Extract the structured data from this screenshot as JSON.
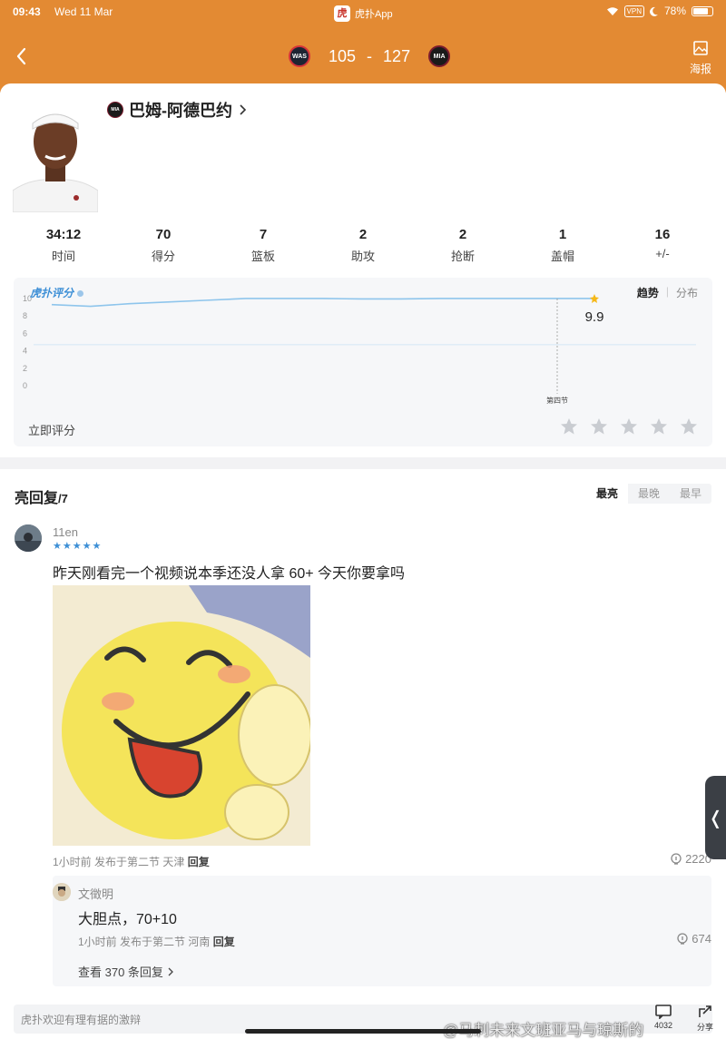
{
  "status_bar": {
    "time": "09:43",
    "date": "Wed 11 Mar",
    "app_name": "虎扑App",
    "vpn": "VPN",
    "battery": "78%"
  },
  "header": {
    "home_team": "WAS",
    "away_team": "MIA",
    "home_score": "105",
    "dash": "-",
    "away_score": "127",
    "poster_label": "海报"
  },
  "player": {
    "name": "巴姆-阿德巴约",
    "team": "MIA",
    "stats": [
      {
        "value": "34:12",
        "label": "时间"
      },
      {
        "value": "70",
        "label": "得分"
      },
      {
        "value": "7",
        "label": "篮板"
      },
      {
        "value": "2",
        "label": "助攻"
      },
      {
        "value": "2",
        "label": "抢断"
      },
      {
        "value": "1",
        "label": "盖帽"
      },
      {
        "value": "16",
        "label": "+/-"
      }
    ]
  },
  "rating": {
    "logo": "虎扑评分",
    "tab_trend": "趋势",
    "tab_distribution": "分布",
    "rate_now": "立即评分",
    "star_count": 5
  },
  "chart_data": {
    "type": "line",
    "title": "",
    "ylim": [
      0,
      10
    ],
    "yticks": [
      "10",
      "8",
      "6",
      "4",
      "2",
      "0"
    ],
    "marker_label": "第四节",
    "current_value": "9.9",
    "series": [
      {
        "values": [
          9.2,
          9.0,
          9.3,
          9.5,
          9.7,
          9.9,
          9.9,
          9.9,
          9.85,
          9.85,
          9.9,
          9.9,
          9.9,
          9.9,
          9.9
        ]
      }
    ],
    "reference_line": 4.6,
    "color": "#8ec5ec"
  },
  "replies": {
    "title": "亮回复",
    "count": "/7",
    "sort_tabs": [
      "最亮",
      "最晚",
      "最早"
    ],
    "comment": {
      "user": "11en",
      "stars": 5,
      "text": "昨天刚看完一个视频说本季还没人拿 60+ 今天你要拿吗",
      "meta": "1小时前 发布于第二节 天津",
      "reply_label": "回复",
      "lights": "2220"
    },
    "sub_reply": {
      "user": "文徵明",
      "text": "大胆点，70+10",
      "meta": "1小时前 发布于第二节 河南",
      "reply_label": "回复",
      "lights": "674",
      "more": "查看 370 条回复"
    }
  },
  "bottom": {
    "placeholder": "虎扑欢迎有理有据的激辩",
    "icon1_count": "4032",
    "icon2_label": "分享"
  },
  "watermark": "@马刺未来文班亚马与琼斯的"
}
